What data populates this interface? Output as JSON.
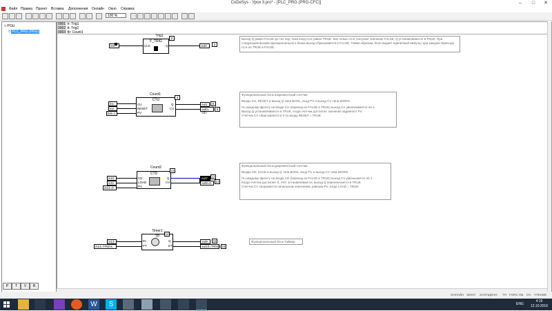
{
  "window": {
    "title": "CoDeSys - Урок 3.pro* - [PLC_PRG (PRG-CFC)]"
  },
  "menu": [
    "Файл",
    "Правка",
    "Проект",
    "Вставка",
    "Дополнения",
    "Онлайн",
    "Окно",
    "Справка"
  ],
  "toolbar": {
    "zoom": "100 %"
  },
  "tree": {
    "root": "POU",
    "item": "PLC_PRG (PRG)"
  },
  "left_tabs": [
    "P",
    "T",
    "V",
    "R"
  ],
  "declarations": [
    {
      "num": "0001",
      "text": "tr: Trig1"
    },
    {
      "num": "0002",
      "text": "tt: Trig2"
    },
    {
      "num": "0003",
      "text": "tb: Count1"
    }
  ],
  "ftrig": {
    "name": "Trig1",
    "type": "F_TRIG",
    "in_pin": "CLK",
    "out_pin": "Q",
    "in_var": "in0",
    "out_var": "out0",
    "in_num": "1",
    "box_num": "2",
    "out_num": "3",
    "comment": "Выход Q равен FALSE до тех пор, пока вход CLK равен TRUE. Как только CLK получает значение FALSE, Q устанавливается в TRUE. При следующем вызове функционального блока выход сбрасывается в FALSE. Таким образом, блок выдает единичный импульс при каждом переходе CLK из TRUE в FALSE."
  },
  "ctu": {
    "name": "Count1",
    "type": "CTU",
    "pins_in": [
      "CU",
      "RESET",
      "PV"
    ],
    "pins_out": [
      "Q",
      "CV"
    ],
    "in_vars": [
      "in1",
      "in2",
      "bnt=1"
    ],
    "out_vars": [
      "out1",
      "out0=<0>"
    ],
    "box_num": "4",
    "out_nums": [
      "5",
      "6"
    ],
    "comment": [
      "Функциональный блок инкрементный счетчик.",
      "",
      "Входы CU, RESET и выход Q типа BOOL, вход PV и выход CV типа WORD.",
      "",
      "По каждому фронту на входе CU (переход из FALSE в TRUE) выход CV увеличивается на 1.",
      "Выход Q устанавливается в TRUE, когда счетчик достигнет значения заданного PV.",
      "Счетчик CV сбрасывается в 0 по входу RESET = TRUE."
    ]
  },
  "ctd": {
    "name": "Count2",
    "type": "CTD",
    "pins_in": [
      "CD",
      "LOAD",
      "PV"
    ],
    "pins_out": [
      "Q",
      "CV"
    ],
    "in_vars": [
      "in10",
      "in11",
      "in12=0"
    ],
    "out_vars": [
      "out7",
      "out8=0"
    ],
    "box_num": "11",
    "out_nums": [
      "12",
      "13"
    ],
    "comment": [
      "Функциональный блок декрементный счетчик.",
      "",
      "Входы CD, LOAD и выход Q типа BOOL, вход PV и выход CV типа WORD.",
      "",
      "По каждому фронту на входе CD (переход из FALSE в TRUE) выход CV уменьшается на 1.",
      "Когда счетчик достигнет 0, счет останавливается, выход Q переключается в TRUE.",
      "Счетчик CV загружается начальным значением, равным PV, когда LOAD = TRUE."
    ]
  },
  "tp": {
    "name": "Timer1",
    "type": "TP",
    "pins_in": [
      "IN",
      "PT"
    ],
    "pins_out": [
      "Q",
      "ET"
    ],
    "in_vars": [
      "in13",
      "in14=T#5ms"
    ],
    "out_vars": [
      "out9",
      "out10=T#0ms"
    ],
    "box_num": "14",
    "out_nums": [
      "15",
      "16"
    ],
    "comment": "Функциональный блок Таймер"
  },
  "status": [
    "ОНЛАЙН",
    "ЭМУЛ",
    "ЗАПУЩЕНО",
    "ТП",
    "FORC",
    "ОБ",
    "OV",
    "ЧТЕНИЕ"
  ],
  "clock": {
    "time": "4:19",
    "date": "12.10.2016"
  },
  "lang": "ENG"
}
